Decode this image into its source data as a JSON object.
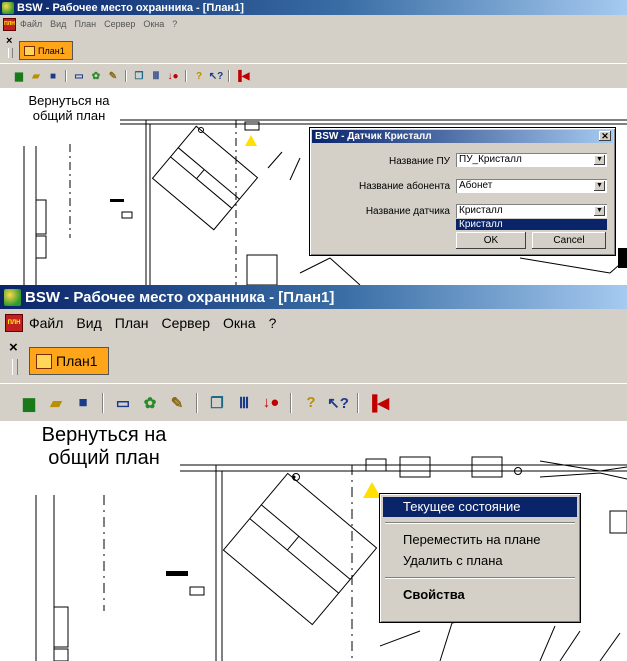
{
  "window": {
    "title": "BSW - Рабочее место охранника - [План1]"
  },
  "menu": {
    "doc_icon": "document-icon",
    "items": [
      "Файл",
      "Вид",
      "План",
      "Сервер",
      "Окна",
      "?"
    ]
  },
  "tabs": [
    {
      "label": "План1"
    }
  ],
  "tabbar": {
    "close_glyph": "×"
  },
  "plan": {
    "back_label": "Вернуться на общий план"
  },
  "toolbar_icons": [
    "new-icon",
    "open-icon",
    "save-icon",
    "monitor-icon",
    "users-icon",
    "tools-icon",
    "windows-icon",
    "columns-icon",
    "alarm-icon",
    "help-icon",
    "context-help-icon",
    "exit-icon"
  ],
  "dialog": {
    "title": "BSW - Датчик Кристалл",
    "close": "✕",
    "fields": [
      {
        "label": "Название ПУ",
        "value": "ПУ_Кристалл"
      },
      {
        "label": "Название абонента",
        "value": "Абонет"
      },
      {
        "label": "Название датчика",
        "value": "Кристалл"
      }
    ],
    "dropdown_selected": "Кристалл",
    "ok": "OK",
    "cancel": "Cancel"
  },
  "context_menu": {
    "items": [
      "Текущее состояние",
      "Переместить на плане",
      "Удалить с плана",
      "Свойства"
    ]
  },
  "colors": {
    "titlebar": "#0a246a",
    "tab": "#ffa51a",
    "warning": "#ffe000",
    "selection": "#0a246a"
  }
}
